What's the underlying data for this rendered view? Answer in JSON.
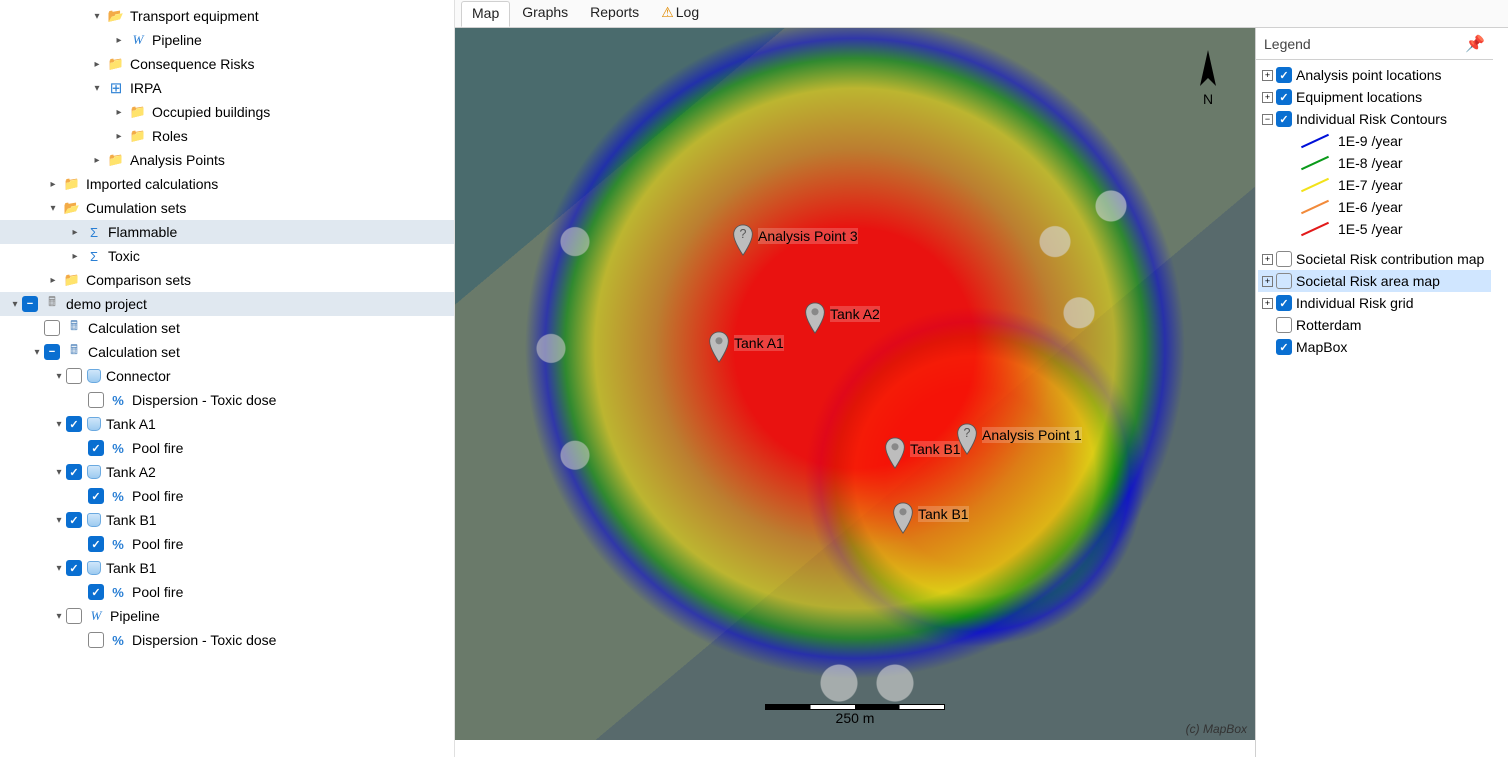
{
  "tree": {
    "top": [
      {
        "lvl": 3,
        "exp": "dn",
        "ico": "folder",
        "txt": "Transport equipment"
      },
      {
        "lvl": 4,
        "exp": "rt",
        "ico": "pipeline",
        "txt": "Pipeline"
      },
      {
        "lvl": 3,
        "exp": "rt",
        "ico": "folderc",
        "txt": "Consequence Risks"
      },
      {
        "lvl": 3,
        "exp": "dn",
        "ico": "irpa",
        "txt": "IRPA"
      },
      {
        "lvl": 4,
        "exp": "rt",
        "ico": "folderc",
        "txt": "Occupied buildings"
      },
      {
        "lvl": 4,
        "exp": "rt",
        "ico": "folderc",
        "txt": "Roles"
      },
      {
        "lvl": 3,
        "exp": "rt",
        "ico": "folderc",
        "txt": "Analysis Points"
      },
      {
        "lvl": 1,
        "exp": "rt",
        "ico": "folderc",
        "txt": "Imported calculations"
      },
      {
        "lvl": 1,
        "exp": "dn",
        "ico": "folder",
        "txt": "Cumulation sets"
      },
      {
        "lvl": 2,
        "exp": "rt",
        "ico": "sigma",
        "txt": "Flammable",
        "sel": true
      },
      {
        "lvl": 2,
        "exp": "rt",
        "ico": "sigma",
        "txt": "Toxic"
      },
      {
        "lvl": 1,
        "exp": "rt",
        "ico": "folderc",
        "txt": "Comparison sets"
      }
    ],
    "project": {
      "txt": "demo project"
    },
    "bottom": [
      {
        "lvl": 0,
        "exp": "dn",
        "chk": "part",
        "ico": "db",
        "txt": "demo project",
        "sel": true
      },
      {
        "lvl": 1,
        "exp": "sp",
        "chk": "off",
        "ico": "calc",
        "txt": "Calculation set"
      },
      {
        "lvl": 1,
        "exp": "dn",
        "chk": "part",
        "ico": "calc",
        "txt": "Calculation set"
      },
      {
        "lvl": 2,
        "exp": "dn",
        "chk": "off",
        "ico": "cyl",
        "txt": "Connector"
      },
      {
        "lvl": 3,
        "exp": "sp",
        "chk": "off",
        "ico": "pct",
        "txt": "Dispersion - Toxic dose"
      },
      {
        "lvl": 2,
        "exp": "dn",
        "chk": "on",
        "ico": "cyl",
        "txt": "Tank A1"
      },
      {
        "lvl": 3,
        "exp": "sp",
        "chk": "on",
        "ico": "pct",
        "txt": "Pool fire"
      },
      {
        "lvl": 2,
        "exp": "dn",
        "chk": "on",
        "ico": "cyl",
        "txt": "Tank A2"
      },
      {
        "lvl": 3,
        "exp": "sp",
        "chk": "on",
        "ico": "pct",
        "txt": "Pool fire"
      },
      {
        "lvl": 2,
        "exp": "dn",
        "chk": "on",
        "ico": "cyl",
        "txt": "Tank B1"
      },
      {
        "lvl": 3,
        "exp": "sp",
        "chk": "on",
        "ico": "pct",
        "txt": "Pool fire"
      },
      {
        "lvl": 2,
        "exp": "dn",
        "chk": "on",
        "ico": "cyl",
        "txt": "Tank B1"
      },
      {
        "lvl": 3,
        "exp": "sp",
        "chk": "on",
        "ico": "pct",
        "txt": "Pool fire"
      },
      {
        "lvl": 2,
        "exp": "dn",
        "chk": "off",
        "ico": "pipeline",
        "txt": "Pipeline"
      },
      {
        "lvl": 3,
        "exp": "sp",
        "chk": "off",
        "ico": "pct",
        "txt": "Dispersion - Toxic dose"
      }
    ]
  },
  "tabs": [
    {
      "label": "Map",
      "active": true
    },
    {
      "label": "Graphs"
    },
    {
      "label": "Reports"
    },
    {
      "label": "Log",
      "warn": true
    }
  ],
  "map": {
    "markers": [
      {
        "x": 36,
        "y": 32,
        "label": "Analysis Point 3",
        "kind": "q"
      },
      {
        "x": 45,
        "y": 43,
        "label": "Tank A2"
      },
      {
        "x": 33,
        "y": 47,
        "label": "Tank A1"
      },
      {
        "x": 55,
        "y": 62,
        "label": "Tank B1"
      },
      {
        "x": 64,
        "y": 60,
        "label": "Analysis Point 1",
        "kind": "q"
      },
      {
        "x": 56,
        "y": 71,
        "label": "Tank B1"
      }
    ],
    "scale_label": "250 m",
    "copyright": "(c) MapBox"
  },
  "legend": {
    "title": "Legend",
    "items": [
      {
        "sq": "p",
        "chk": "on",
        "txt": "Analysis point locations"
      },
      {
        "sq": "p",
        "chk": "on",
        "txt": "Equipment locations"
      },
      {
        "sq": "m",
        "chk": "on",
        "txt": "Individual Risk Contours"
      }
    ],
    "contours": [
      {
        "color": "#0010d8",
        "txt": "1E-9 /year"
      },
      {
        "color": "#0a9a1a",
        "txt": "1E-8 /year"
      },
      {
        "color": "#f2e21a",
        "txt": "1E-7 /year"
      },
      {
        "color": "#f28a3a",
        "txt": "1E-6 /year"
      },
      {
        "color": "#e21a1a",
        "txt": "1E-5 /year"
      }
    ],
    "items2": [
      {
        "sq": "p",
        "chk": "off",
        "txt": "Societal Risk contribution map"
      },
      {
        "sq": "p",
        "chk": "off",
        "txt": "Societal Risk area map",
        "sel": true
      },
      {
        "sq": "p",
        "chk": "on",
        "txt": "Individual Risk grid"
      },
      {
        "sq": "sp",
        "chk": "off",
        "txt": "Rotterdam"
      },
      {
        "sq": "sp",
        "chk": "on",
        "txt": "MapBox"
      }
    ]
  }
}
